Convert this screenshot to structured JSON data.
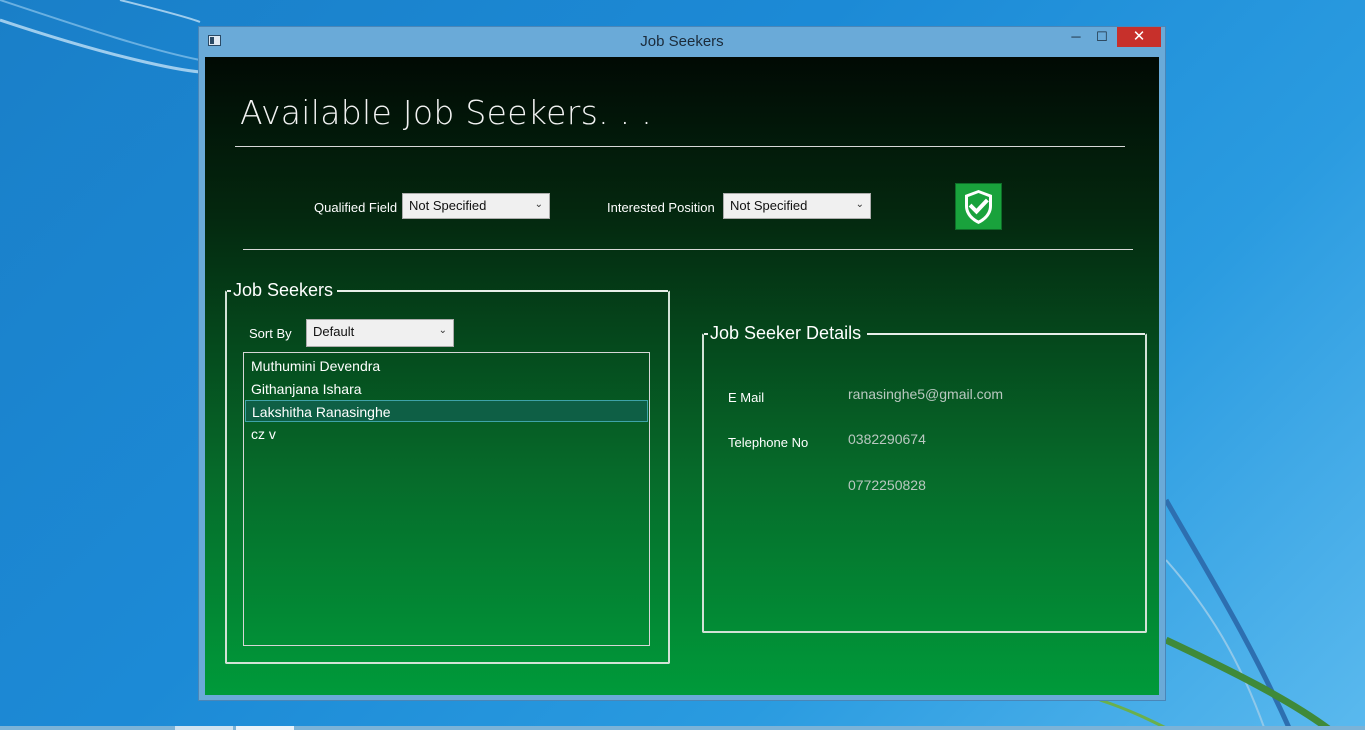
{
  "window": {
    "title": "Job Seekers"
  },
  "header": {
    "heading": "Available Job Seekers. . ."
  },
  "filters": {
    "qualified_label": "Qualified Field",
    "qualified_value": "Not Specified",
    "position_label": "Interested Position",
    "position_value": "Not Specified",
    "apply_icon": "shield-check-icon"
  },
  "seekers_group": {
    "title": "Job Seekers",
    "sort_label": "Sort By",
    "sort_value": "Default",
    "items": [
      {
        "name": "Muthumini Devendra"
      },
      {
        "name": "Githanjana Ishara"
      },
      {
        "name": "Lakshitha Ranasinghe",
        "selected": true
      },
      {
        "name": "cz v"
      }
    ]
  },
  "details_group": {
    "title": "Job Seeker Details",
    "email_label": "E Mail",
    "email_value": "ranasinghe5@gmail.com",
    "phone_label": "Telephone No",
    "phone_1": "0382290674",
    "phone_2": "0772250828"
  },
  "colors": {
    "accent_green": "#19a23c",
    "close_red": "#c7302b",
    "selection": "#0e5f45"
  }
}
